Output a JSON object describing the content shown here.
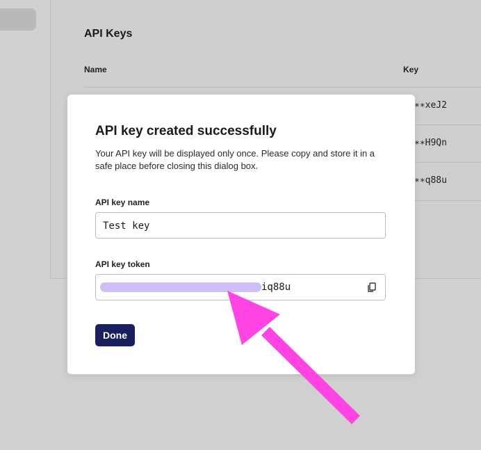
{
  "background": {
    "panel_title": "API Keys",
    "columns": {
      "name": "Name",
      "key": "Key"
    },
    "rows": [
      {
        "masked_key": "∗∗xeJ2"
      },
      {
        "masked_key": "∗∗H9Qn"
      },
      {
        "masked_key": "∗∗q88u"
      }
    ]
  },
  "dialog": {
    "title": "API key created successfully",
    "description": "Your API key will be displayed only once. Please copy and store it in a safe place before closing this dialog box.",
    "name_label": "API key name",
    "name_value": "Test key",
    "token_label": "API key token",
    "token_visible_tail": "iq88u",
    "copy_icon": "copy-icon",
    "done_label": "Done"
  },
  "annotation": {
    "arrow_color": "#ff44e3",
    "redaction_color": "#cbbcf6"
  },
  "colors": {
    "overlay_bg": "#d0d0d0",
    "primary_button": "#1a1f5e"
  }
}
